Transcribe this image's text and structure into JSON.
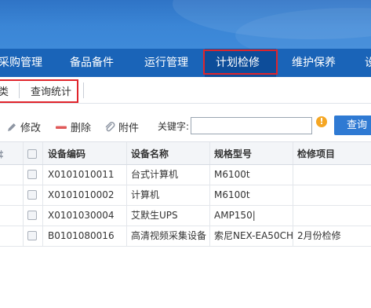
{
  "nav": {
    "items": [
      {
        "label": "采购管理"
      },
      {
        "label": "备品备件"
      },
      {
        "label": "运行管理"
      },
      {
        "label": "计划检修"
      },
      {
        "label": "维护保养"
      },
      {
        "label": "设"
      }
    ]
  },
  "subtabs": {
    "items": [
      {
        "label": "类"
      },
      {
        "label": "查询统计"
      }
    ]
  },
  "toolbar": {
    "edit_label": "修改",
    "delete_label": "删除",
    "attach_label": "附件",
    "keyword_label": "关键字:",
    "keyword_value": "",
    "query_label": "查询"
  },
  "table": {
    "columns": [
      "设备编码",
      "设备名称",
      "规格型号",
      "检修项目"
    ],
    "rows": [
      [
        "X0101010011",
        "台式计算机",
        "M6100t",
        ""
      ],
      [
        "X0101010002",
        "计算机",
        "M6100t",
        ""
      ],
      [
        "X0101030004",
        "艾默生UPS",
        "AMP150|",
        ""
      ],
      [
        "B0101080016",
        "高清视频采集设备",
        "索尼NEX-EA50CH",
        "2月份检修"
      ]
    ]
  }
}
